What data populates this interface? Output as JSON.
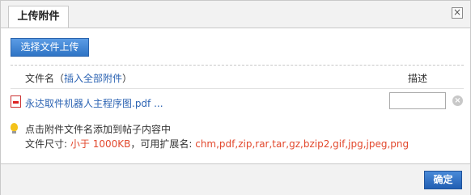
{
  "dialog": {
    "tab_label": "上传附件",
    "close_symbol": "×"
  },
  "upload_button": "选择文件上传",
  "table": {
    "filename_header": "文件名",
    "insert_all_open": "（",
    "insert_all_label": "插入全部附件",
    "insert_all_close": "）",
    "desc_header": "描述"
  },
  "file": {
    "name": "永达取件机器人主程序图.pdf ...",
    "description_value": "",
    "delete_symbol": "×"
  },
  "tips": {
    "line1": "点击附件文件名添加到帖子内容中",
    "size_label": "文件尺寸:",
    "size_value": "小于 1000KB",
    "ext_label": "，可用扩展名:",
    "ext_value": "chm,pdf,zip,rar,tar,gz,bzip2,gif,jpg,jpeg,png"
  },
  "footer": {
    "confirm_label": "确定"
  },
  "icons": {
    "file": "pdf-icon",
    "tip": "lightbulb-icon",
    "delete": "delete-icon",
    "close": "close-icon"
  },
  "colors": {
    "accent": "#2f74c5",
    "link": "#2d64b3",
    "highlight": "#e2482d"
  }
}
